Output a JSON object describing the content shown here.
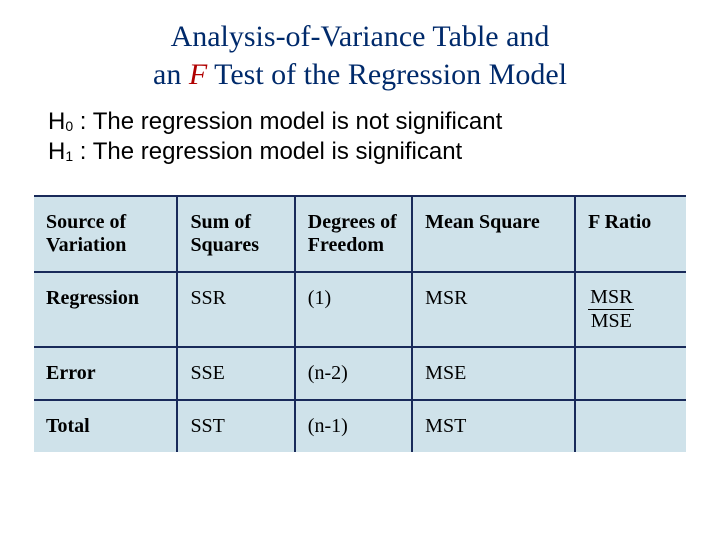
{
  "title": {
    "part1": "Analysis-of-Variance Table and",
    "part2a": "an ",
    "part2b": "F",
    "part2c": " Test of the Regression Model"
  },
  "hypotheses": {
    "h0_label": "H",
    "h0_sub": "0",
    "h0_text": " : The regression model is not significant",
    "h1_label": "H",
    "h1_sub": "1",
    "h1_text": " : The regression model is significant"
  },
  "table": {
    "headers": {
      "source": "Source of Variation",
      "ss": "Sum of Squares",
      "df": "Degrees of Freedom",
      "ms": "Mean Square",
      "f": "F Ratio"
    },
    "rows": [
      {
        "label": "Regression",
        "ss": "SSR",
        "df": "(1)",
        "ms": "MSR",
        "f_num": "MSR",
        "f_den": "MSE"
      },
      {
        "label": "Error",
        "ss": "SSE",
        "df": "(n-2)",
        "ms": "MSE",
        "f_num": "",
        "f_den": ""
      },
      {
        "label": "Total",
        "ss": "SST",
        "df": "(n-1)",
        "ms": "MST",
        "f_num": "",
        "f_den": ""
      }
    ]
  }
}
